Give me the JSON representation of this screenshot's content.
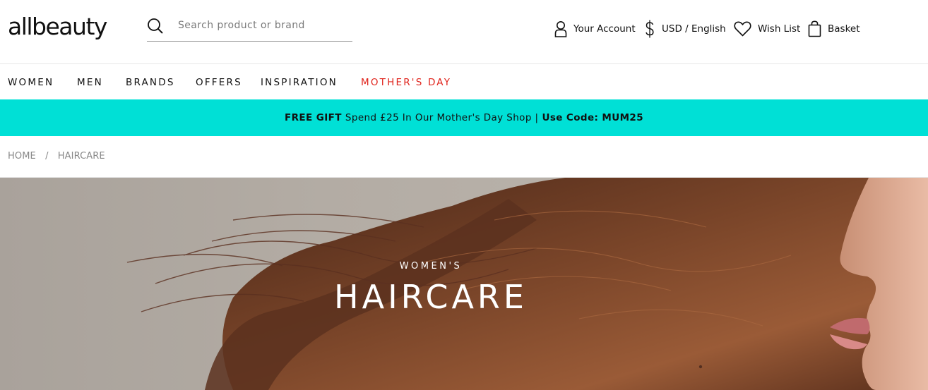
{
  "header": {
    "logo": "allbeauty",
    "search": {
      "placeholder": "Search product or brand",
      "value": ""
    },
    "account_label": "Your Account",
    "currency_label": "USD / English",
    "wishlist_label": "Wish List",
    "basket_label": "Basket"
  },
  "nav": {
    "items": [
      "WOMEN",
      "MEN",
      "BRANDS",
      "OFFERS",
      "INSPIRATION",
      "MOTHER'S DAY"
    ]
  },
  "promo": {
    "bold_lead": "FREE GIFT",
    "text": "Spend £25 In Our Mother's Day Shop |",
    "code": "Use Code: MUM25"
  },
  "breadcrumb": {
    "items": [
      "HOME",
      "HAIRCARE"
    ],
    "separator": "/"
  },
  "hero": {
    "subtitle": "WOMEN'S",
    "title": "HAIRCARE"
  },
  "colors": {
    "promo_bg": "#00e0d6",
    "accent": "#e0231b",
    "hero_bg": "#b9b2aa",
    "hair": "#6a3a24"
  },
  "icons": {
    "search": "search-icon",
    "account": "user-icon",
    "currency": "dollar-icon",
    "wishlist": "heart-icon",
    "basket": "shopping-bag-icon"
  }
}
